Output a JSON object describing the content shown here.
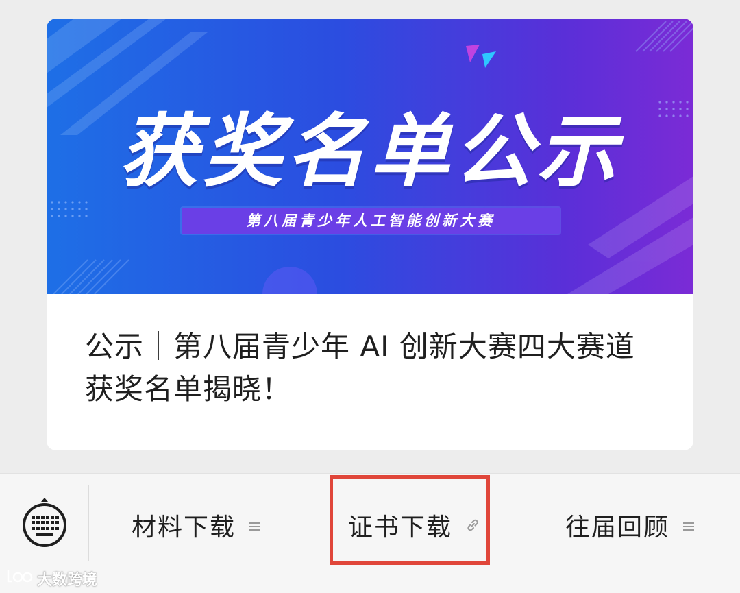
{
  "banner": {
    "title": "获奖名单公示",
    "subtitle": "第八届青少年人工智能创新大赛"
  },
  "article": {
    "title": "公示｜第八届青少年 AI 创新大赛四大赛道获奖名单揭晓！"
  },
  "menu": {
    "items": [
      {
        "label": "材料下载",
        "icon": "menu-lines-icon"
      },
      {
        "label": "证书下载",
        "icon": "link-icon"
      },
      {
        "label": "往届回顾",
        "icon": "menu-lines-icon"
      }
    ]
  },
  "watermark": {
    "text": "大数跨境"
  },
  "colors": {
    "highlight": "#e0463a",
    "background": "#ededed",
    "banner_start": "#1e6fe6",
    "banner_end": "#7b2bd6"
  }
}
